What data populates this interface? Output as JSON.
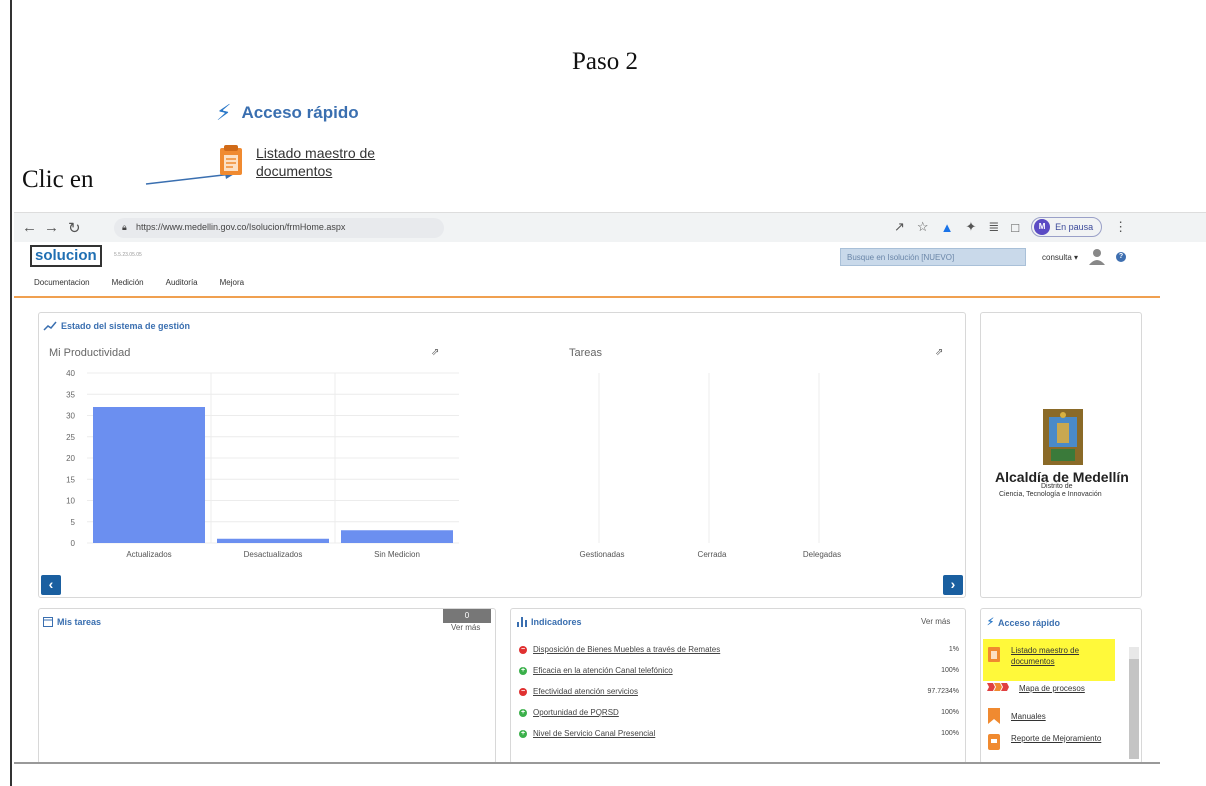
{
  "doc": {
    "step_label": "Paso 2",
    "instruction": "Clic en"
  },
  "zoom": {
    "title": "Acceso rápido",
    "link_label": "Listado maestro de documentos"
  },
  "browser": {
    "url": "https://www.medellin.gov.co/Isolucion/frmHome.aspx",
    "profile_initial": "M",
    "profile_status": "En pausa"
  },
  "app": {
    "logo": "solucion",
    "version": "5.5.23.05.05",
    "search_placeholder": "Busque en Isolución [NUEVO]",
    "user_label": "consulta ▾",
    "menu": [
      "Documentacion",
      "Medición",
      "Auditoría",
      "Mejora"
    ]
  },
  "estado": {
    "title": "Estado del sistema de gestión",
    "productividad_title": "Mi Productividad",
    "tareas_title": "Tareas"
  },
  "chart_data": [
    {
      "type": "bar",
      "title": "Mi Productividad",
      "categories": [
        "Actualizados",
        "Desactualizados",
        "Sin Medicion"
      ],
      "values": [
        32,
        1,
        3
      ],
      "ylim": [
        0,
        40
      ],
      "yticks": [
        0,
        5,
        10,
        15,
        20,
        25,
        30,
        35,
        40
      ],
      "color": "#6b8ff0",
      "grid": true
    },
    {
      "type": "bar",
      "title": "Tareas",
      "categories": [
        "Gestionadas",
        "Cerrada",
        "Delegadas"
      ],
      "values": [
        0,
        0,
        0
      ],
      "grid": true
    }
  ],
  "mis_tareas": {
    "title": "Mis tareas",
    "count": "0",
    "ver_mas": "Ver más"
  },
  "indicadores": {
    "title": "Indicadores",
    "ver_mas": "Ver más",
    "rows": [
      {
        "name": "Disposición de Bienes Muebles a través de Remates",
        "value": "1%",
        "status": "red"
      },
      {
        "name": "Eficacia en la atención Canal telefónico",
        "value": "100%",
        "status": "green"
      },
      {
        "name": "Efectividad atención servicios",
        "value": "97.7234%",
        "status": "red"
      },
      {
        "name": "Oportunidad de PQRSD",
        "value": "100%",
        "status": "green"
      },
      {
        "name": "Nivel de Servicio Canal Presencial",
        "value": "100%",
        "status": "green"
      }
    ]
  },
  "acceso": {
    "title": "Acceso rápido",
    "items": [
      {
        "label": "Listado maestro de documentos",
        "icon": "clipboard-icon"
      },
      {
        "label": "Mapa de procesos",
        "icon": "process-map-icon"
      },
      {
        "label": "Manuales",
        "icon": "bookmark-icon"
      },
      {
        "label": "Reporte de Mejoramiento",
        "icon": "report-icon"
      }
    ]
  },
  "alcaldia": {
    "name": "Alcaldía de Medellín",
    "distrito": "Distrito de",
    "subtitle": "Ciencia, Tecnología e Innovación"
  },
  "colors": {
    "accent_blue": "#3a6fb0",
    "bar_blue": "#6b8ff0",
    "orange": "#f0a050",
    "highlight": "#fff93a",
    "status_red": "#e03030",
    "status_green": "#3ab04a"
  }
}
